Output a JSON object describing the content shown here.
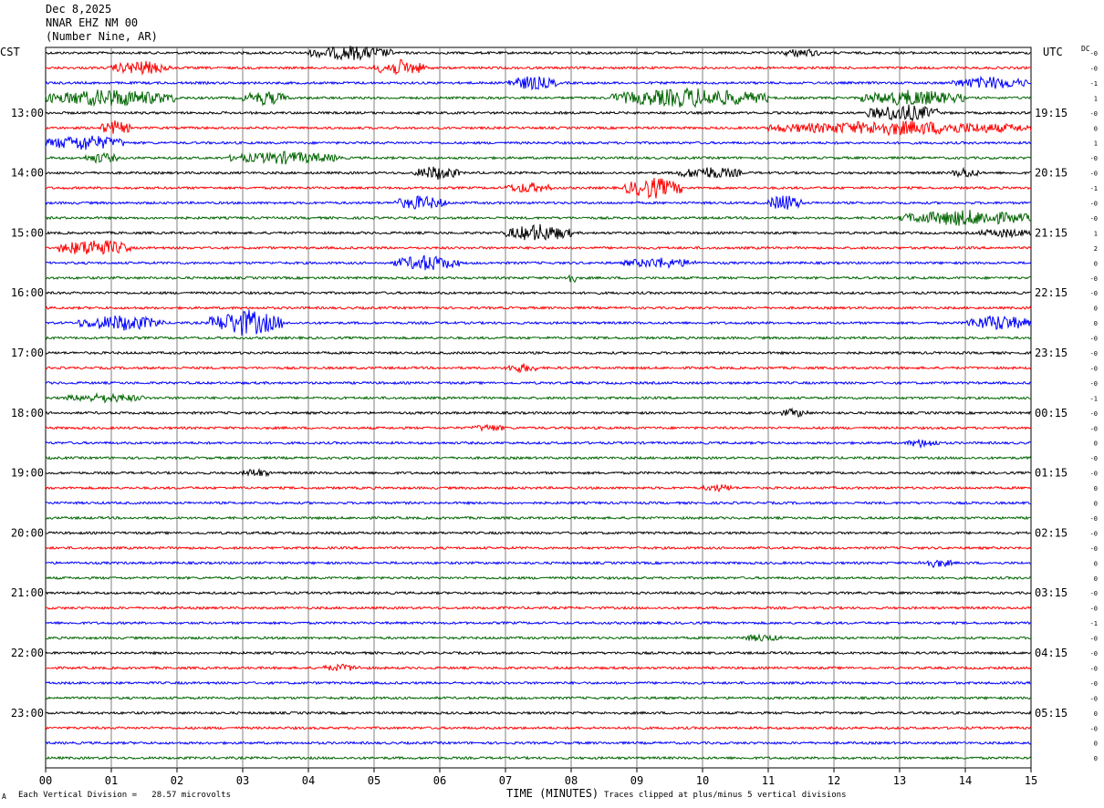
{
  "header": {
    "date": "Dec 8,2025",
    "station": "NNAR EHZ NM 00",
    "location": "(Number Nine, AR)"
  },
  "left_tz": "CST",
  "right_tz": "UTC",
  "dc_label": "DC",
  "footer": {
    "scale_note": "Each Vertical Division =   28.57 microvolts",
    "clip_note": "Traces clipped at plus/minus 5 vertical divisions",
    "x_title": "TIME (MINUTES)",
    "corner_mark": "A"
  },
  "colors": {
    "trace_cycle": [
      "#000000",
      "#ff0000",
      "#0000ff",
      "#006400"
    ],
    "grid": "#808080"
  },
  "chart_data": {
    "type": "line",
    "title": "NNAR EHZ NM 00 (Number Nine, AR)",
    "xlabel": "TIME (MINUTES)",
    "x_ticks": [
      "00",
      "01",
      "02",
      "03",
      "04",
      "05",
      "06",
      "07",
      "08",
      "09",
      "10",
      "11",
      "12",
      "13",
      "14",
      "15"
    ],
    "xlim": [
      0,
      15
    ],
    "trace_count": 48,
    "minutes_per_trace": 15,
    "left_time_labels": [
      "13:00",
      "14:00",
      "15:00",
      "16:00",
      "17:00",
      "18:00",
      "19:00",
      "20:00",
      "21:00",
      "22:00",
      "23:00"
    ],
    "right_time_labels": [
      "19:15",
      "20:15",
      "21:15",
      "22:15",
      "23:15",
      "00:15",
      "01:15",
      "02:15",
      "03:15",
      "04:15",
      "05:15"
    ],
    "hour_label_every_traces": 4,
    "hour_label_first_trace": 4,
    "dc_offsets": [
      "-0",
      "-0",
      "-1",
      "1",
      "-0",
      "0",
      "1",
      "-0",
      "-0",
      "-1",
      "-0",
      "-0",
      "1",
      "2",
      "0",
      "-0",
      "-0",
      "0",
      "0",
      "-0",
      "-0",
      "-0",
      "-0",
      "-1",
      "-0",
      "-0",
      "0",
      "-0",
      "-0",
      "0",
      "0",
      "-0",
      "-0",
      "-0",
      "0",
      "0",
      "-0",
      "-0",
      "-1",
      "-0",
      "-0",
      "-0",
      "-0",
      "-0",
      "0",
      "-0",
      "0",
      "0"
    ],
    "events": [
      {
        "trace": 0,
        "start_min": 4.0,
        "end_min": 5.3,
        "amplitude": 7
      },
      {
        "trace": 0,
        "start_min": 11.2,
        "end_min": 11.8,
        "amplitude": 4
      },
      {
        "trace": 1,
        "start_min": 1.0,
        "end_min": 1.9,
        "amplitude": 7
      },
      {
        "trace": 1,
        "start_min": 5.0,
        "end_min": 5.8,
        "amplitude": 8
      },
      {
        "trace": 2,
        "start_min": 7.0,
        "end_min": 7.8,
        "amplitude": 7
      },
      {
        "trace": 2,
        "start_min": 13.8,
        "end_min": 15.0,
        "amplitude": 6
      },
      {
        "trace": 3,
        "start_min": 0.0,
        "end_min": 2.0,
        "amplitude": 9
      },
      {
        "trace": 3,
        "start_min": 3.0,
        "end_min": 3.7,
        "amplitude": 7
      },
      {
        "trace": 3,
        "start_min": 8.6,
        "end_min": 11.0,
        "amplitude": 10
      },
      {
        "trace": 3,
        "start_min": 12.4,
        "end_min": 14.0,
        "amplitude": 8
      },
      {
        "trace": 4,
        "start_min": 12.5,
        "end_min": 13.6,
        "amplitude": 9
      },
      {
        "trace": 5,
        "start_min": 0.8,
        "end_min": 1.3,
        "amplitude": 7
      },
      {
        "trace": 5,
        "start_min": 11.0,
        "end_min": 15.0,
        "amplitude": 7
      },
      {
        "trace": 6,
        "start_min": 0.0,
        "end_min": 1.2,
        "amplitude": 8
      },
      {
        "trace": 7,
        "start_min": 0.6,
        "end_min": 1.1,
        "amplitude": 5
      },
      {
        "trace": 7,
        "start_min": 2.8,
        "end_min": 4.5,
        "amplitude": 6
      },
      {
        "trace": 8,
        "start_min": 5.6,
        "end_min": 6.3,
        "amplitude": 7
      },
      {
        "trace": 8,
        "start_min": 9.6,
        "end_min": 10.6,
        "amplitude": 6
      },
      {
        "trace": 8,
        "start_min": 13.8,
        "end_min": 14.2,
        "amplitude": 5
      },
      {
        "trace": 9,
        "start_min": 7.0,
        "end_min": 7.7,
        "amplitude": 5
      },
      {
        "trace": 9,
        "start_min": 8.8,
        "end_min": 9.7,
        "amplitude": 11
      },
      {
        "trace": 10,
        "start_min": 5.3,
        "end_min": 6.1,
        "amplitude": 7
      },
      {
        "trace": 10,
        "start_min": 11.0,
        "end_min": 11.5,
        "amplitude": 9
      },
      {
        "trace": 11,
        "start_min": 13.0,
        "end_min": 15.0,
        "amplitude": 8
      },
      {
        "trace": 12,
        "start_min": 7.0,
        "end_min": 8.0,
        "amplitude": 9
      },
      {
        "trace": 12,
        "start_min": 14.2,
        "end_min": 15.0,
        "amplitude": 4
      },
      {
        "trace": 13,
        "start_min": 0.2,
        "end_min": 1.3,
        "amplitude": 9
      },
      {
        "trace": 14,
        "start_min": 5.3,
        "end_min": 6.3,
        "amplitude": 8
      },
      {
        "trace": 14,
        "start_min": 8.8,
        "end_min": 9.9,
        "amplitude": 5
      },
      {
        "trace": 15,
        "start_min": 7.9,
        "end_min": 8.1,
        "amplitude": 5
      },
      {
        "trace": 18,
        "start_min": 0.5,
        "end_min": 1.8,
        "amplitude": 8
      },
      {
        "trace": 18,
        "start_min": 2.5,
        "end_min": 3.6,
        "amplitude": 14
      },
      {
        "trace": 18,
        "start_min": 14.0,
        "end_min": 15.0,
        "amplitude": 8
      },
      {
        "trace": 21,
        "start_min": 7.0,
        "end_min": 7.5,
        "amplitude": 4
      },
      {
        "trace": 23,
        "start_min": 0.3,
        "end_min": 1.5,
        "amplitude": 4
      },
      {
        "trace": 24,
        "start_min": 11.2,
        "end_min": 11.6,
        "amplitude": 4
      },
      {
        "trace": 25,
        "start_min": 6.5,
        "end_min": 7.0,
        "amplitude": 3
      },
      {
        "trace": 26,
        "start_min": 13.1,
        "end_min": 13.6,
        "amplitude": 4
      },
      {
        "trace": 28,
        "start_min": 3.0,
        "end_min": 3.4,
        "amplitude": 4
      },
      {
        "trace": 29,
        "start_min": 10.0,
        "end_min": 10.5,
        "amplitude": 3
      },
      {
        "trace": 34,
        "start_min": 13.3,
        "end_min": 13.8,
        "amplitude": 4
      },
      {
        "trace": 39,
        "start_min": 10.6,
        "end_min": 11.2,
        "amplitude": 3
      },
      {
        "trace": 41,
        "start_min": 4.2,
        "end_min": 4.8,
        "amplitude": 3
      }
    ]
  }
}
